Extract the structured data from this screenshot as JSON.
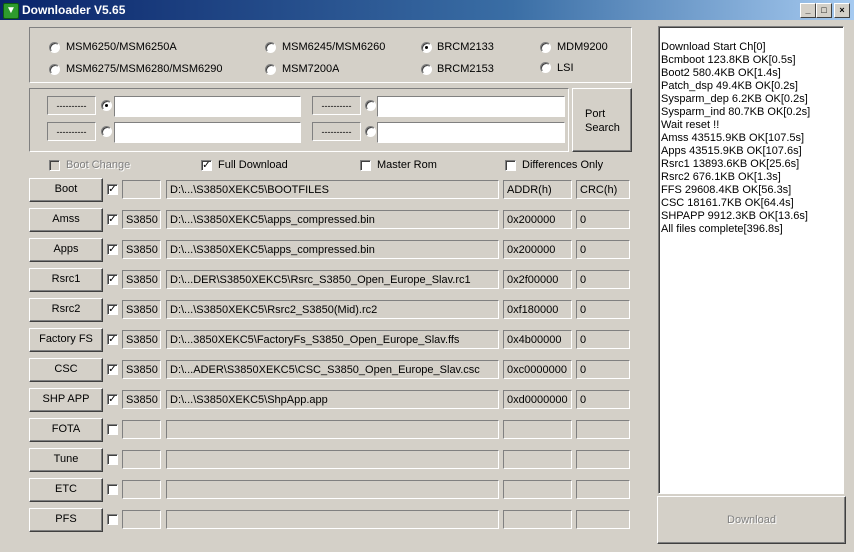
{
  "window": {
    "title": "Downloader V5.65",
    "controls": [
      "_",
      "□",
      "×"
    ]
  },
  "chipsets": [
    {
      "label": "MSM6250/MSM6250A",
      "selected": false
    },
    {
      "label": "MSM6245/MSM6260",
      "selected": false
    },
    {
      "label": "BRCM2133",
      "selected": true
    },
    {
      "label": "MDM9200",
      "selected": false
    },
    {
      "label": "MSM6275/MSM6280/MSM6290",
      "selected": false
    },
    {
      "label": "MSM7200A",
      "selected": false
    },
    {
      "label": "BRCM2153",
      "selected": false
    },
    {
      "label": "LSI",
      "selected": false
    }
  ],
  "ports": [
    {
      "status": "----------",
      "selected": true,
      "value": ""
    },
    {
      "status": "----------",
      "selected": false,
      "value": ""
    },
    {
      "status": "----------",
      "selected": false,
      "value": ""
    },
    {
      "status": "----------",
      "selected": false,
      "value": ""
    }
  ],
  "port_search_label": "Port\nSearch",
  "options": {
    "boot_change": {
      "label": "Boot Change",
      "checked": false,
      "enabled": false
    },
    "full_download": {
      "label": "Full Download",
      "checked": true
    },
    "master_rom": {
      "label": "Master Rom",
      "checked": false
    },
    "differences_only": {
      "label": "Differences Only",
      "checked": false
    }
  },
  "header": {
    "addr": "ADDR(h)",
    "crc": "CRC(h)"
  },
  "files": [
    {
      "label": "Boot",
      "checked": true,
      "model": "",
      "path": "D:\\...\\S3850XEKC5\\BOOTFILES",
      "addr": "",
      "crc": ""
    },
    {
      "label": "Amss",
      "checked": true,
      "model": "S3850",
      "path": "D:\\...\\S3850XEKC5\\apps_compressed.bin",
      "addr": "0x200000",
      "crc": "0"
    },
    {
      "label": "Apps",
      "checked": true,
      "model": "S3850",
      "path": "D:\\...\\S3850XEKC5\\apps_compressed.bin",
      "addr": "0x200000",
      "crc": "0"
    },
    {
      "label": "Rsrc1",
      "checked": true,
      "model": "S3850",
      "path": "D:\\...DER\\S3850XEKC5\\Rsrc_S3850_Open_Europe_Slav.rc1",
      "addr": "0x2f00000",
      "crc": "0"
    },
    {
      "label": "Rsrc2",
      "checked": true,
      "model": "S3850",
      "path": "D:\\...\\S3850XEKC5\\Rsrc2_S3850(Mid).rc2",
      "addr": "0xf180000",
      "crc": "0"
    },
    {
      "label": "Factory FS",
      "checked": true,
      "model": "S3850",
      "path": "D:\\...3850XEKC5\\FactoryFs_S3850_Open_Europe_Slav.ffs",
      "addr": "0x4b00000",
      "crc": "0"
    },
    {
      "label": "CSC",
      "checked": true,
      "model": "S3850",
      "path": "D:\\...ADER\\S3850XEKC5\\CSC_S3850_Open_Europe_Slav.csc",
      "addr": "0xc0000000",
      "crc": "0"
    },
    {
      "label": "SHP APP",
      "checked": true,
      "model": "S3850",
      "path": "D:\\...\\S3850XEKC5\\ShpApp.app",
      "addr": "0xd0000000",
      "crc": "0"
    },
    {
      "label": "FOTA",
      "checked": false,
      "model": "",
      "path": "",
      "addr": "",
      "crc": ""
    },
    {
      "label": "Tune",
      "checked": false,
      "model": "",
      "path": "",
      "addr": "",
      "crc": ""
    },
    {
      "label": "ETC",
      "checked": false,
      "model": "",
      "path": "",
      "addr": "",
      "crc": ""
    },
    {
      "label": "PFS",
      "checked": false,
      "model": "",
      "path": "",
      "addr": "",
      "crc": ""
    }
  ],
  "log": [
    "Download Start Ch[0]",
    "Bcmboot 123.8KB OK[0.5s]",
    "Boot2 580.4KB OK[1.4s]",
    "Patch_dsp 49.4KB OK[0.2s]",
    "Sysparm_dep 6.2KB OK[0.2s]",
    "Sysparm_ind 80.7KB OK[0.2s]",
    "Wait reset !!",
    "Amss 43515.9KB OK[107.5s]",
    "Apps 43515.9KB OK[107.6s]",
    "Rsrc1 13893.6KB OK[25.6s]",
    "Rsrc2 676.1KB OK[1.3s]",
    "FFS 29608.4KB OK[56.3s]",
    "CSC 18161.7KB OK[64.4s]",
    "SHPAPP 9912.3KB OK[13.6s]",
    "All files complete[396.8s]"
  ],
  "download_button": "Download"
}
